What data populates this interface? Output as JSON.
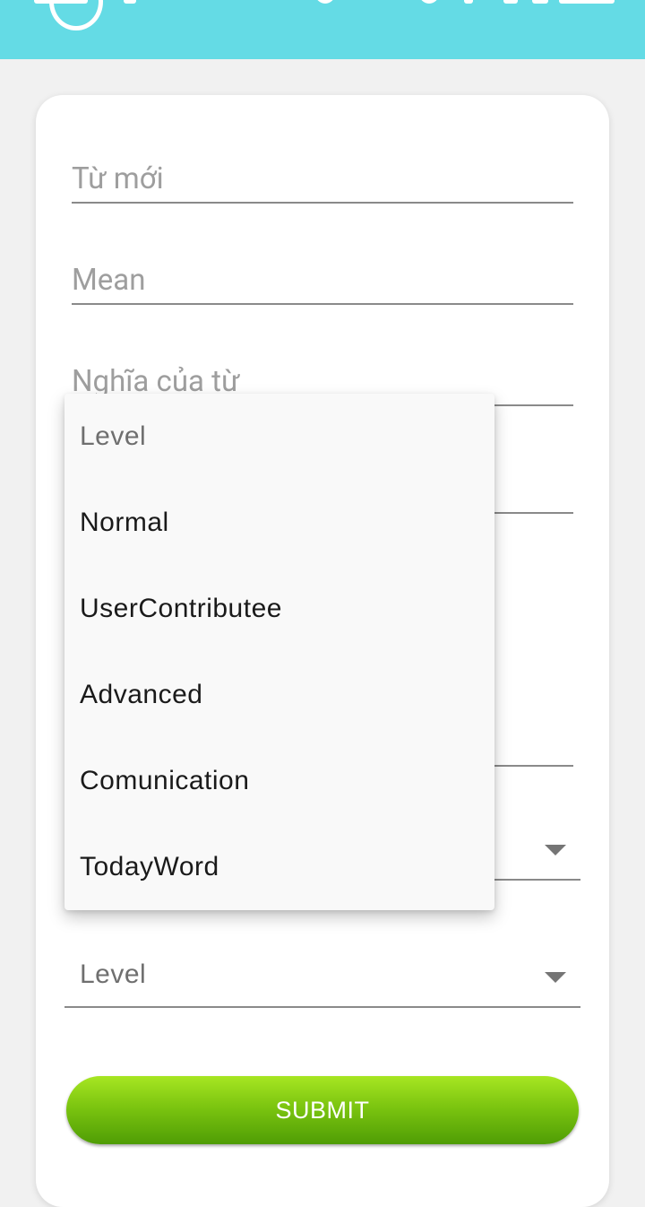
{
  "form": {
    "new_word_placeholder": "Từ mới",
    "mean_placeholder": "Mean",
    "meaning_placeholder": "Nghĩa của từ",
    "level_select_value": "Level",
    "submit_label": "SUBMIT"
  },
  "level_dropdown": {
    "options": [
      "Level",
      "Normal",
      "UserContributee",
      "Advanced",
      "Comunication",
      "TodayWord"
    ]
  },
  "colors": {
    "topbar": "#64dbe5",
    "submit_top": "#a7e622",
    "submit_bottom": "#4f9d05"
  }
}
